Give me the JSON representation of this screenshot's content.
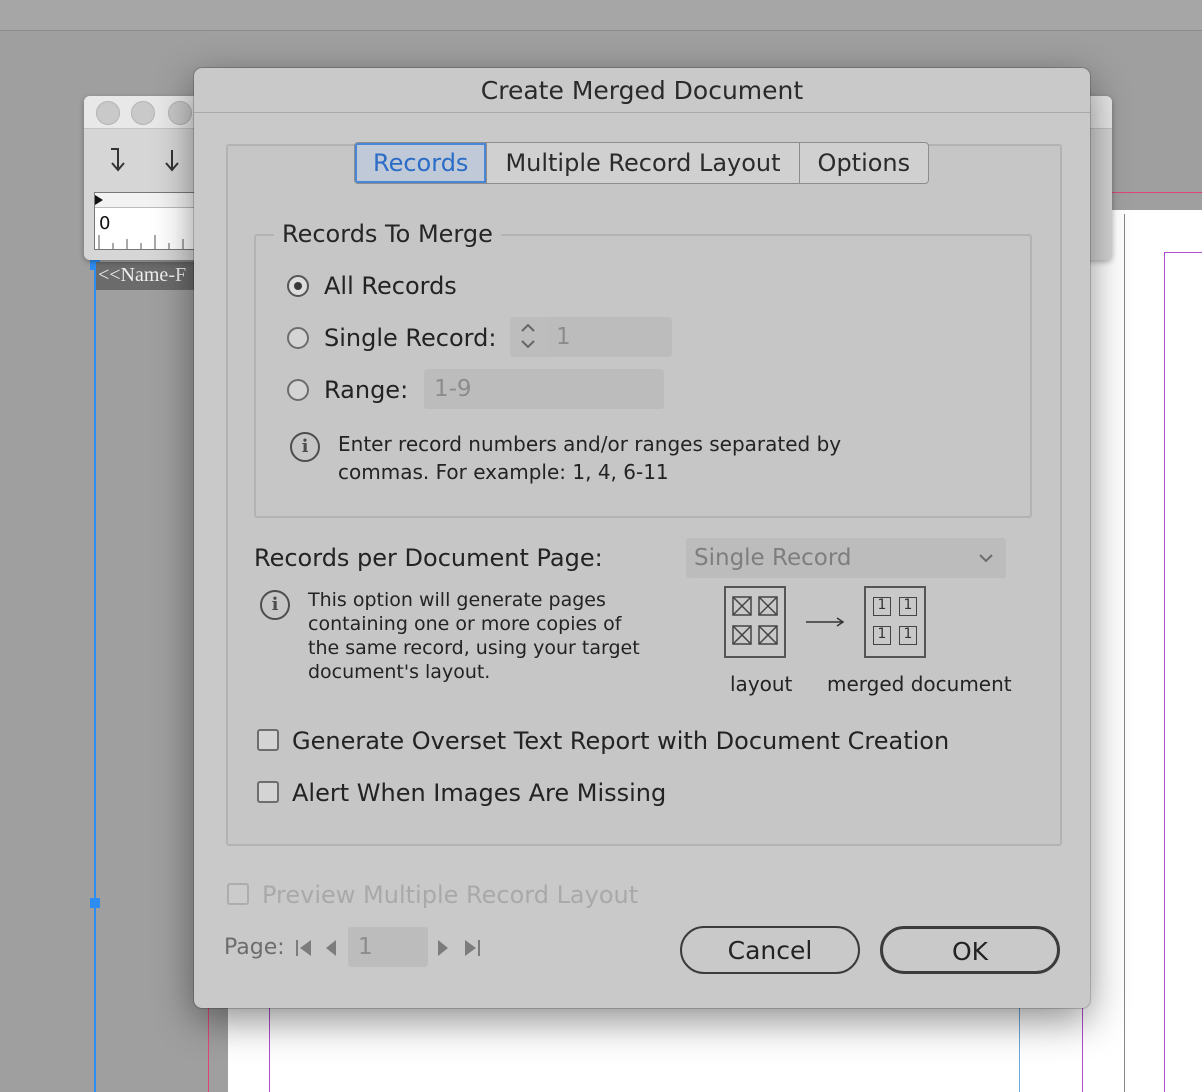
{
  "background_app": {
    "text_frame_label": "<<Name-F",
    "ruler_zero": "0",
    "tool_icons": [
      "align-top-arrow-icon",
      "arrow-down-icon"
    ]
  },
  "dialog": {
    "title": "Create Merged Document",
    "tabs": [
      {
        "label": "Records",
        "active": true
      },
      {
        "label": "Multiple Record Layout",
        "active": false
      },
      {
        "label": "Options",
        "active": false
      }
    ],
    "records_to_merge": {
      "group_label": "Records To Merge",
      "all_records_label": "All Records",
      "single_record_label": "Single Record:",
      "single_record_value": "1",
      "range_label": "Range:",
      "range_value": "1-9",
      "selected": "All Records",
      "info_line1": "Enter record numbers and/or ranges separated by",
      "info_line2": "commas. For example: 1, 4, 6-11"
    },
    "records_per_page": {
      "label": "Records per Document Page:",
      "selected": "Single Record",
      "info_lines": [
        "This option will generate pages",
        "containing one or more copies of",
        "the same record, using your target",
        "document's layout."
      ],
      "diagram_caption_left": "layout",
      "diagram_caption_right": "merged document",
      "diagram_cell_value": "1"
    },
    "checkboxes": {
      "overset_report_label": "Generate Overset Text Report with Document Creation",
      "overset_report_checked": false,
      "images_missing_label": "Alert When Images Are Missing",
      "images_missing_checked": false,
      "preview_label": "Preview Multiple Record Layout",
      "preview_checked": false
    },
    "page_nav": {
      "label": "Page:",
      "value": "1"
    },
    "buttons": {
      "cancel": "Cancel",
      "ok": "OK"
    }
  }
}
